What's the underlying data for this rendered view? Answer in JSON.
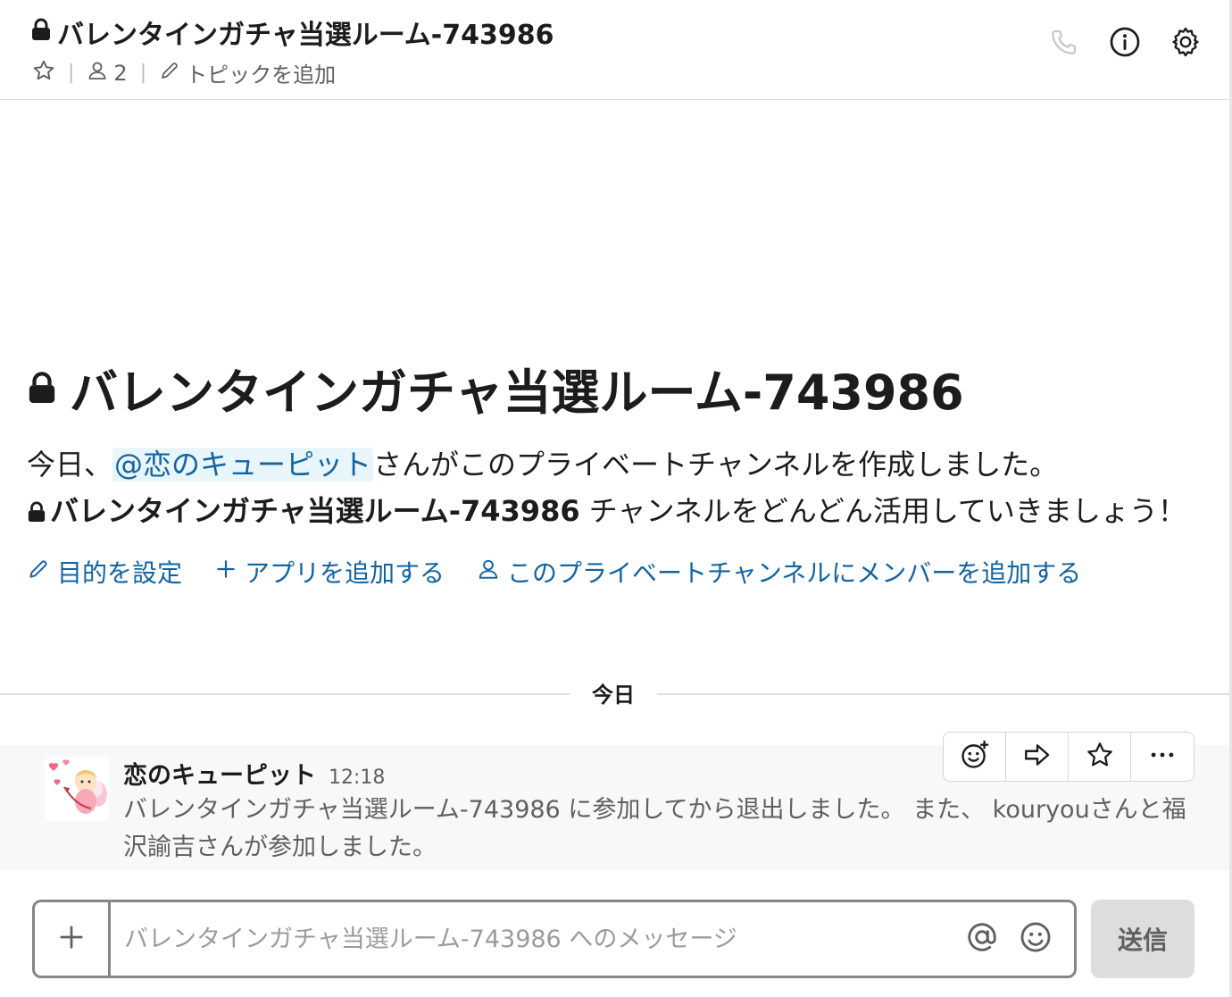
{
  "header": {
    "title": "バレンタインガチャ当選ルーム-743986",
    "member_count": "2",
    "topic_label": "トピックを追加"
  },
  "intro": {
    "title": "バレンタインガチャ当選ルーム-743986",
    "line_prefix": "今日、",
    "mention": "@恋のキューピット",
    "line_suffix": "さんがこのプライベートチャンネルを作成しました。",
    "channel_name": "バレンタインガチャ当選ルーム-743986",
    "channel_suffix": " チャンネルをどんどん活用していきましょう！",
    "actions": {
      "purpose": "目的を設定",
      "add_app": "アプリを追加する",
      "add_member": "このプライベートチャンネルにメンバーを追加する"
    }
  },
  "divider": {
    "label": "今日"
  },
  "message": {
    "sender": "恋のキューピット",
    "time": "12:18",
    "body": "バレンタインガチャ当選ルーム-743986 に参加してから退出しました。 また、 kouryouさんと福沢諭吉さんが参加しました。"
  },
  "composer": {
    "placeholder": "バレンタインガチャ当選ルーム-743986 へのメッセージ",
    "send_label": "送信"
  },
  "colors": {
    "link": "#1264a3",
    "mention_bg": "#e8f5fa",
    "text": "#1d1c1d",
    "muted": "#616061",
    "message_bg": "#f8f8f8"
  },
  "icons": [
    "lock-icon",
    "star-icon",
    "person-icon",
    "pencil-icon",
    "phone-icon",
    "info-icon",
    "gear-icon",
    "plus-icon",
    "add-reaction-icon",
    "share-arrow-icon",
    "more-icon",
    "at-icon",
    "emoji-icon"
  ]
}
